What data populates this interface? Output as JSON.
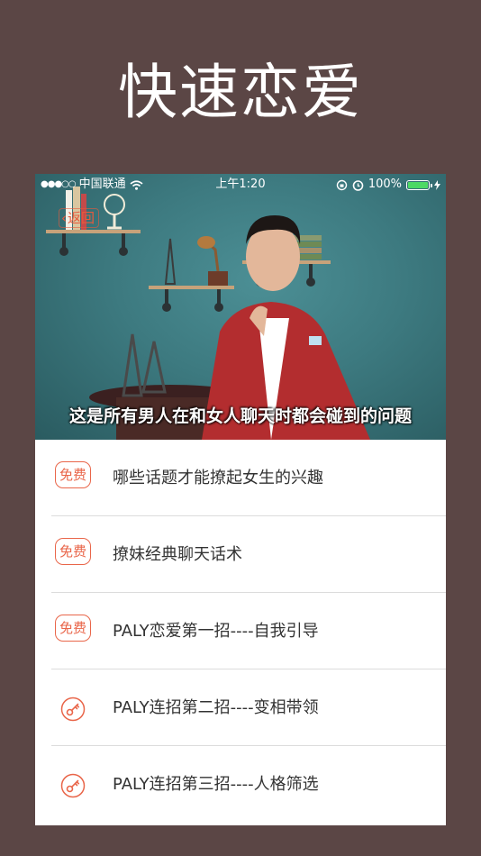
{
  "headline": "快速恋爱",
  "status_bar": {
    "signal": "●●●○○",
    "carrier": "中国联通",
    "wifi_icon": "wifi-icon",
    "time": "上午1:20",
    "battery_percent": "100%",
    "battery_level": 1.0
  },
  "video": {
    "back_label": "返回",
    "subtitle": "这是所有男人在和女人聊天时都会碰到的问题"
  },
  "lessons": [
    {
      "badge": "免费",
      "title": "哪些话题才能撩起女生的兴趣",
      "icon": "free-badge"
    },
    {
      "badge": "免费",
      "title": "撩妹经典聊天话术",
      "icon": "free-badge"
    },
    {
      "badge": "免费",
      "title": "PALY恋爱第一招----自我引导",
      "icon": "free-badge"
    },
    {
      "badge": "",
      "title": "PALY连招第二招----变相带领",
      "icon": "key-icon"
    },
    {
      "badge": "",
      "title": "PALY连招第三招----人格筛选",
      "icon": "key-icon"
    }
  ],
  "colors": {
    "background": "#5b4645",
    "accent": "#e9664a"
  }
}
